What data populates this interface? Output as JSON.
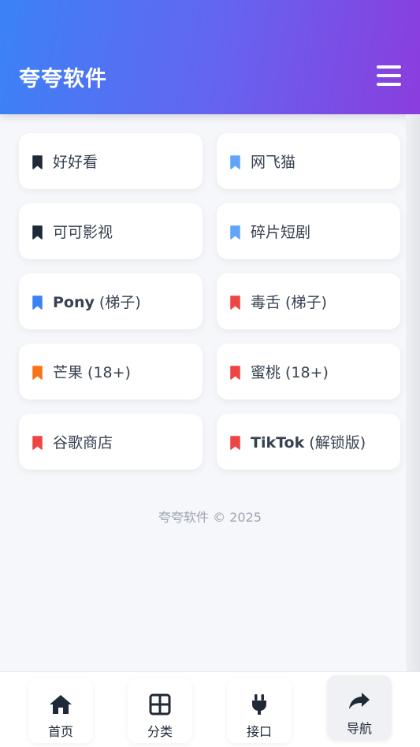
{
  "header": {
    "title": "夸夸软件"
  },
  "cards": [
    {
      "name": "card-haohaokan",
      "bookmark_color": "#1f2937",
      "bold": "",
      "label": "好好看"
    },
    {
      "name": "card-wangfeimao",
      "bookmark_color": "#60a5fa",
      "bold": "",
      "label": "网飞猫"
    },
    {
      "name": "card-kekeyingshi",
      "bookmark_color": "#1f2937",
      "bold": "",
      "label": "可可影视"
    },
    {
      "name": "card-suipianduanju",
      "bookmark_color": "#60a5fa",
      "bold": "",
      "label": "碎片短剧"
    },
    {
      "name": "card-pony",
      "bookmark_color": "#3b82f6",
      "bold": "Pony",
      "label": " (梯子)"
    },
    {
      "name": "card-dushe",
      "bookmark_color": "#ef4444",
      "bold": "",
      "label": "毒舌 (梯子)"
    },
    {
      "name": "card-mangguo",
      "bookmark_color": "#f97316",
      "bold": "",
      "label": "芒果 (18+)"
    },
    {
      "name": "card-mitao",
      "bookmark_color": "#ef4444",
      "bold": "",
      "label": "蜜桃 (18+)"
    },
    {
      "name": "card-gugeshangdian",
      "bookmark_color": "#ef4444",
      "bold": "",
      "label": "谷歌商店"
    },
    {
      "name": "card-tiktok",
      "bookmark_color": "#ef4444",
      "bold": "TikTok",
      "label": " (解锁版)"
    }
  ],
  "footer": {
    "text": "夸夸软件 © 2025"
  },
  "nav": [
    {
      "label": "首页",
      "icon": "home-icon"
    },
    {
      "label": "分类",
      "icon": "grid-icon"
    },
    {
      "label": "接口",
      "icon": "plug-icon"
    },
    {
      "label": "导航",
      "icon": "share-icon"
    }
  ]
}
